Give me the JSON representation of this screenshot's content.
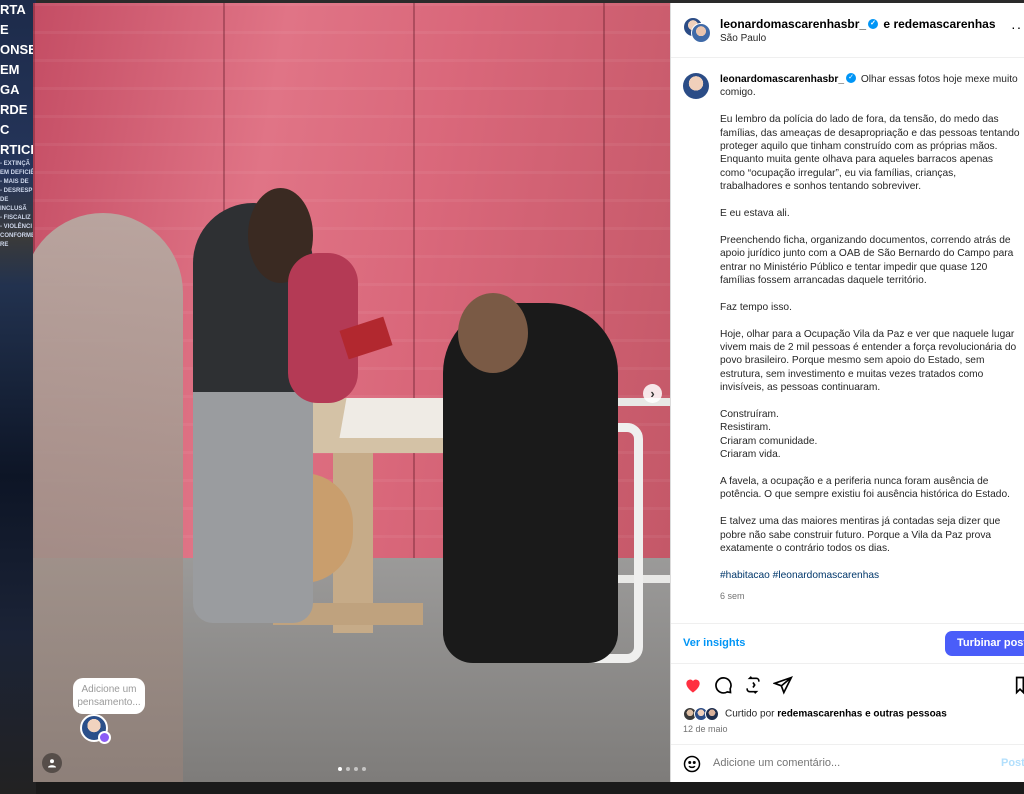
{
  "background": {
    "strips": [
      "RTA E",
      "ONSEL",
      "EM GA",
      "RDE C",
      "RTICIP",
      "- EXTINÇÃ",
      "EM DEFICIÊ",
      "- MAIS DE",
      "- DESRESP",
      "DE INCLUSÃ",
      "- FISCALIZ",
      "- VIOLÊNCI",
      "CONFORME RE"
    ]
  },
  "photo": {
    "next_icon": "chevron-right-icon",
    "thought_prompt": "Adicione um pensamento..."
  },
  "post": {
    "header": {
      "author": "leonardomascarenhasbr_",
      "joiner": "e",
      "coauthor": "redemascarenhas",
      "location": "São Paulo"
    },
    "caption": {
      "author": "leonardomascarenhasbr_",
      "lead": "Olhar essas fotos hoje mexe muito comigo.",
      "paragraphs": [
        "Eu lembro da polícia do lado de fora, da tensão, do medo das famílias, das ameaças de desapropriação e das pessoas tentando proteger aquilo que tinham construído com as próprias mãos. Enquanto muita gente olhava para aqueles barracos apenas como “ocupação irregular”, eu via famílias, crianças, trabalhadores e sonhos tentando sobreviver.",
        "E eu estava ali.",
        "Preenchendo ficha, organizando documentos, correndo atrás de apoio jurídico junto com a OAB de São Bernardo do Campo para entrar no Ministério Público e tentar impedir que quase 120 famílias fossem arrancadas daquele território.",
        "Faz tempo isso.",
        "Hoje, olhar para a Ocupação Vila da Paz e ver que naquele lugar vivem mais de 2 mil pessoas é entender a força revolucionária do povo brasileiro. Porque mesmo sem apoio do Estado, sem estrutura, sem investimento e muitas vezes tratados como invisíveis, as pessoas continuaram.",
        "Construíram.\nResistiram.\nCriaram comunidade.\nCriaram vida.",
        "A favela, a ocupação e a periferia nunca foram ausência de potência. O que sempre existiu foi ausência histórica do Estado.",
        "E talvez uma das maiores mentiras já contadas seja dizer que pobre não sabe construir futuro. Porque a Vila da Paz prova exatamente o contrário todos os dias."
      ],
      "hashtags": "#habitacao #leonardomascarenhas",
      "age": "6 sem"
    },
    "insights_label": "Ver insights",
    "boost_label": "Turbinar post",
    "liked_by": {
      "prefix": "Curtido por",
      "user": "redemascarenhas",
      "suffix": "e outras pessoas"
    },
    "date": "12 de maio",
    "comment_placeholder": "Adicione um comentário...",
    "post_label": "Postar",
    "colors": {
      "accent": "#0095f6",
      "boost": "#4a5df9",
      "like": "#ff3040"
    }
  }
}
